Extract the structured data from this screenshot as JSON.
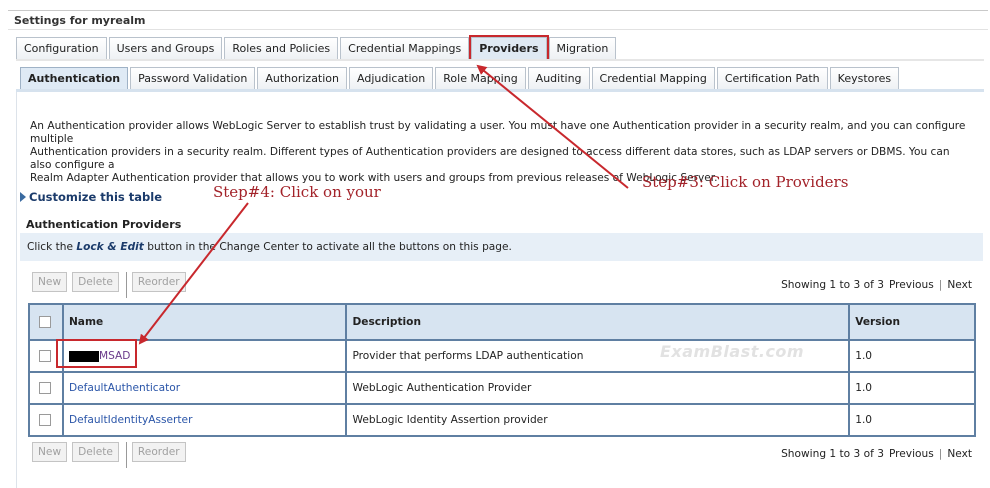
{
  "panel": {
    "title": "Settings for myrealm"
  },
  "tabs_main": [
    {
      "label": "Configuration"
    },
    {
      "label": "Users and Groups"
    },
    {
      "label": "Roles and Policies"
    },
    {
      "label": "Credential Mappings"
    },
    {
      "label": "Providers",
      "active": true,
      "highlighted": true
    },
    {
      "label": "Migration"
    }
  ],
  "tabs_sub": [
    {
      "label": "Authentication",
      "active": true
    },
    {
      "label": "Password Validation"
    },
    {
      "label": "Authorization"
    },
    {
      "label": "Adjudication"
    },
    {
      "label": "Role Mapping"
    },
    {
      "label": "Auditing"
    },
    {
      "label": "Credential Mapping"
    },
    {
      "label": "Certification Path"
    },
    {
      "label": "Keystores"
    }
  ],
  "intro": {
    "line1": "An Authentication provider allows WebLogic Server to establish trust by validating a user. You must have one Authentication provider in a security realm, and you can configure multiple",
    "line2": "Authentication providers in a security realm. Different types of Authentication providers are designed to access different data stores, such as LDAP servers or DBMS. You can also configure a",
    "line3": "Realm Adapter Authentication provider that allows you to work with users and groups from previous releases of WebLogic Server."
  },
  "customize": {
    "label": "Customize this table",
    "icon": "expand-triangle-icon"
  },
  "section": {
    "title": "Authentication Providers"
  },
  "lock_bar": {
    "before": "Click the ",
    "emph": "Lock & Edit",
    "after": " button in the Change Center to activate all the buttons on this page."
  },
  "buttons": {
    "new": "New",
    "delete": "Delete",
    "reorder": "Reorder"
  },
  "pager": {
    "showing": "Showing 1 to 3 of 3",
    "previous": "Previous",
    "next": "Next",
    "sep": "|"
  },
  "table": {
    "headers": {
      "name": "Name",
      "description": "Description",
      "version": "Version"
    },
    "rows": [
      {
        "name": "MSAD",
        "description": "Provider that performs LDAP authentication",
        "version": "1.0"
      },
      {
        "name": "DefaultAuthenticator",
        "description": "WebLogic Authentication Provider",
        "version": "1.0"
      },
      {
        "name": "DefaultIdentityAsserter",
        "description": "WebLogic Identity Assertion provider",
        "version": "1.0"
      }
    ]
  },
  "watermark": "ExamBlast.com",
  "annotations": {
    "step3": "Step#3: Click on Providers",
    "step4": "Step#4: Click on your"
  },
  "colors": {
    "annotation_red": "#c8282d",
    "table_border": "#5f7fa2",
    "header_bg": "#d7e4f1",
    "link_blue": "#2a55a8"
  }
}
